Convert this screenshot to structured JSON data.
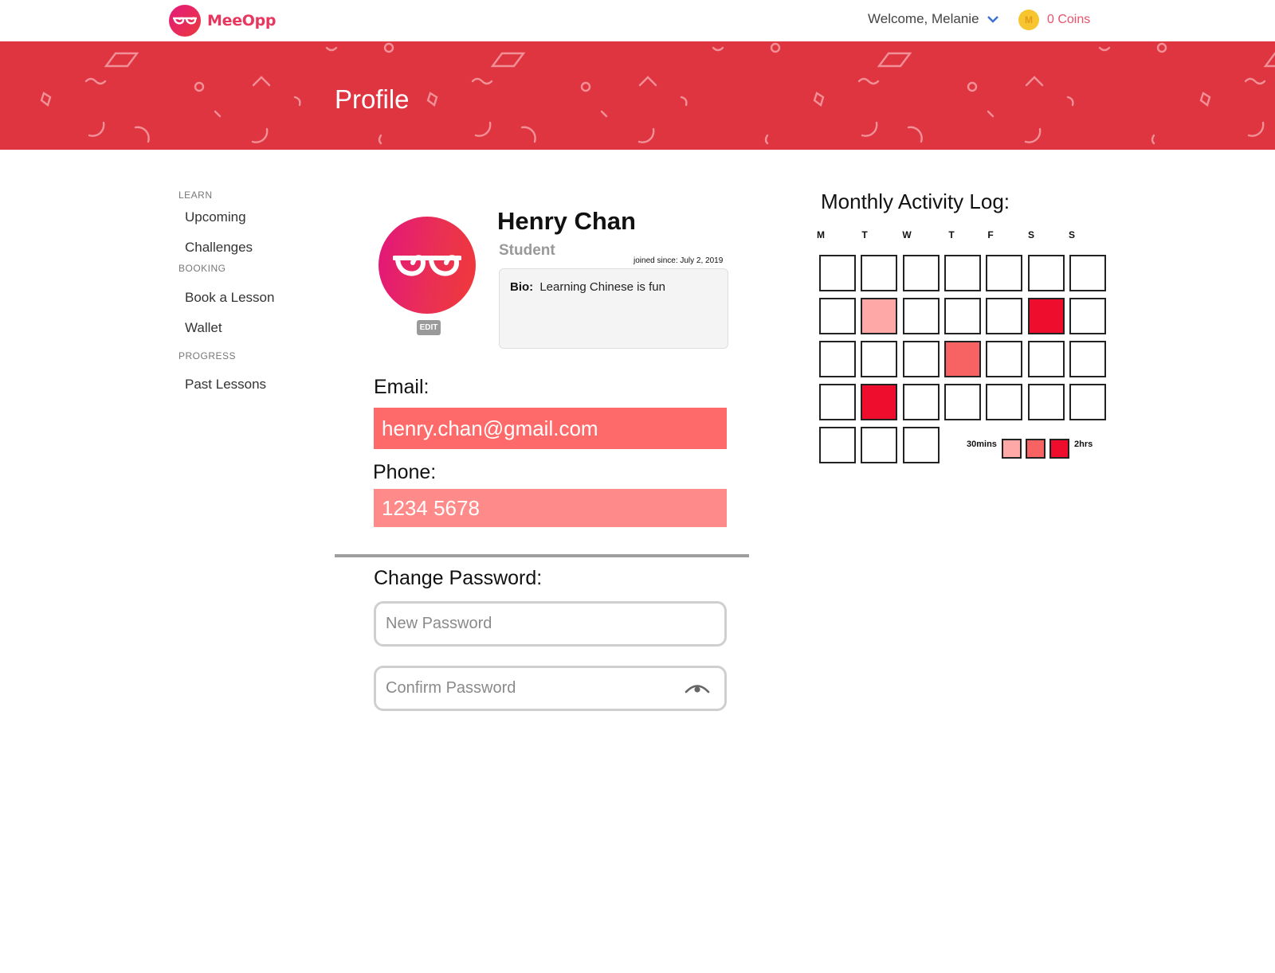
{
  "header": {
    "brand": "MeeOpp",
    "welcome": "Welcome, Melanie",
    "coin_symbol": "M",
    "coins_label": "0 Coins"
  },
  "banner": {
    "title": "Profile",
    "color": "#de3541"
  },
  "sidebar": {
    "sections": [
      {
        "title": "LEARN",
        "items": [
          "Upcoming",
          "Challenges"
        ]
      },
      {
        "title": "BOOKING",
        "items": [
          "Book a Lesson",
          "Wallet"
        ]
      },
      {
        "title": "PROGRESS",
        "items": [
          "Past Lessons"
        ]
      }
    ]
  },
  "profile": {
    "edit_label": "EDIT",
    "name": "Henry Chan",
    "role": "Student",
    "joined": "joined since: July 2, 2019",
    "bio_label": "Bio:",
    "bio": "Learning Chinese is fun",
    "email_label": "Email:",
    "email": "henry.chan@gmail.com",
    "phone_label": "Phone:",
    "phone": "1234 5678"
  },
  "password": {
    "title": "Change Password:",
    "new_placeholder": "New Password",
    "confirm_placeholder": "Confirm Password"
  },
  "activity": {
    "title": "Monthly Activity Log:",
    "days": [
      "M",
      "T",
      "W",
      "T",
      "F",
      "S",
      "S"
    ],
    "weeks": [
      [
        0,
        0,
        0,
        0,
        0,
        0,
        0
      ],
      [
        0,
        1,
        0,
        0,
        0,
        3,
        0
      ],
      [
        0,
        0,
        0,
        2,
        0,
        0,
        0
      ],
      [
        0,
        3,
        0,
        0,
        0,
        0,
        0
      ],
      [
        0,
        0,
        0
      ]
    ],
    "legend_min": "30mins",
    "legend_max": "2hrs",
    "level_colors": [
      "#ffffff",
      "#ffa8a8",
      "#f76262",
      "#ee0d2c"
    ]
  }
}
